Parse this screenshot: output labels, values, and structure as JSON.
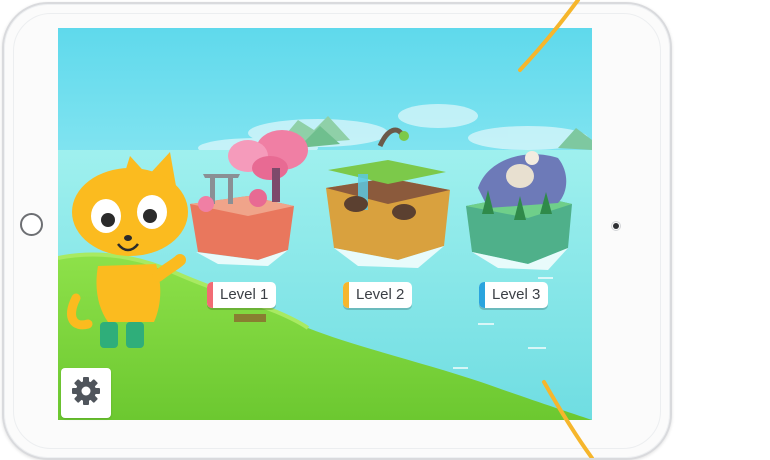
{
  "levels": [
    {
      "label": "Level 1",
      "color": "#f26b74"
    },
    {
      "label": "Level 2",
      "color": "#f6b62c"
    },
    {
      "label": "Level 3",
      "color": "#2aa4de"
    }
  ],
  "icons": {
    "settings": "gear-icon"
  },
  "colors": {
    "sky": "#6fe0f0",
    "grass": "#7dd23e",
    "cat": "#fbbb1f",
    "accent_arc": "#f6b62c"
  }
}
